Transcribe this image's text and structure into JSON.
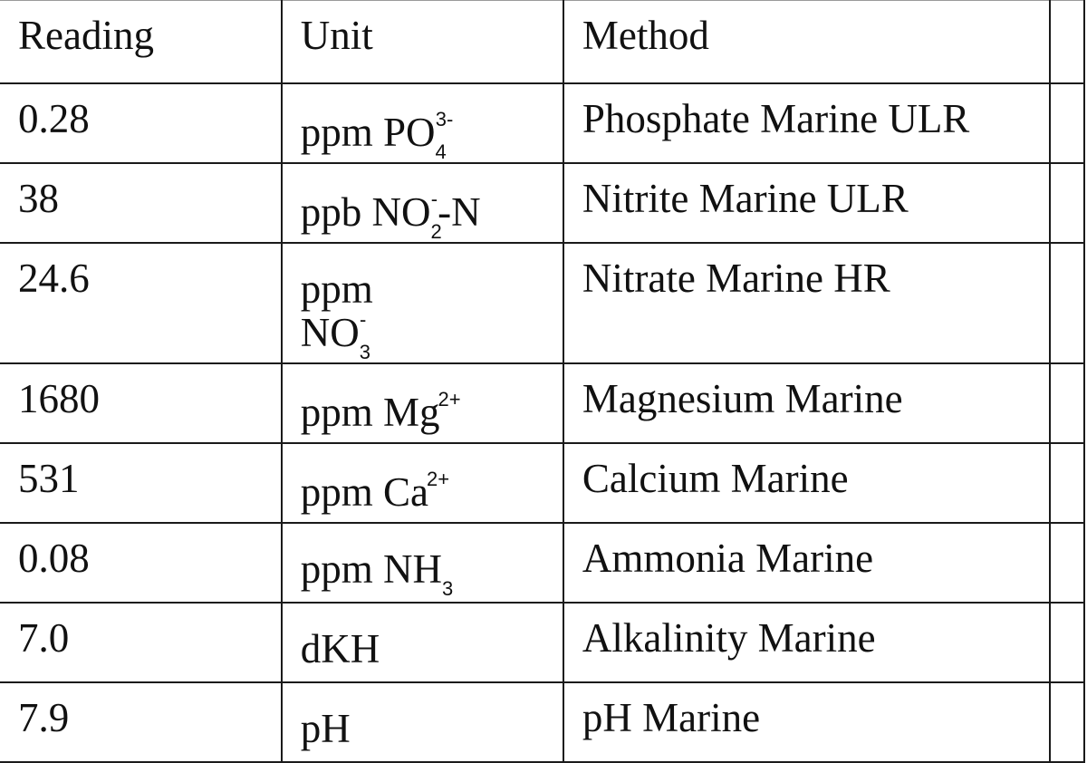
{
  "table": {
    "headers": [
      "Reading",
      "Unit",
      "Method",
      ""
    ],
    "rows": [
      {
        "reading": "0.28",
        "unit": {
          "prefix": "ppm PO",
          "sub": "4",
          "sup": "3-",
          "suffix": ""
        },
        "method": "Phosphate Marine ULR"
      },
      {
        "reading": "38",
        "unit": {
          "prefix": "ppb NO",
          "sub": "2",
          "sup": "-",
          "suffix": "-N"
        },
        "method": "Nitrite Marine ULR"
      },
      {
        "reading": "24.6",
        "unit": {
          "prefix": "ppm NO",
          "sub": "3",
          "sup": "-",
          "suffix": ""
        },
        "method": "Nitrate Marine HR"
      },
      {
        "reading": "1680",
        "unit": {
          "prefix": "ppm Mg",
          "sub": "",
          "sup": "2+",
          "suffix": ""
        },
        "method": "Magnesium Marine"
      },
      {
        "reading": "531",
        "unit": {
          "prefix": "ppm Ca",
          "sub": "",
          "sup": "2+",
          "suffix": ""
        },
        "method": "Calcium Marine"
      },
      {
        "reading": "0.08",
        "unit": {
          "prefix": "ppm NH",
          "sub": "3",
          "sup": "",
          "suffix": ""
        },
        "method": "Ammonia Marine"
      },
      {
        "reading": "7.0",
        "unit": {
          "prefix": "dKH",
          "sub": "",
          "sup": "",
          "suffix": ""
        },
        "method": "Alkalinity Marine"
      },
      {
        "reading": "7.9",
        "unit": {
          "prefix": "pH",
          "sub": "",
          "sup": "",
          "suffix": ""
        },
        "method": "pH Marine"
      }
    ]
  }
}
